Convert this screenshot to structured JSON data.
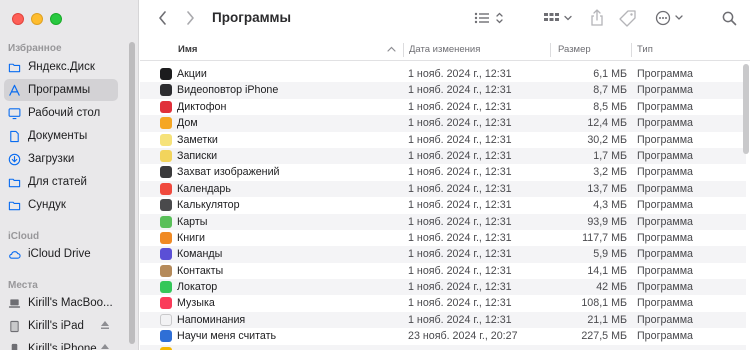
{
  "window": {
    "title": "Программы"
  },
  "sidebar": {
    "favorites_title": "Избранное",
    "favorites": [
      {
        "label": "Яндекс.Диск",
        "icon": "folder-icon"
      },
      {
        "label": "Программы",
        "icon": "applications-icon",
        "selected": true
      },
      {
        "label": "Рабочий стол",
        "icon": "desktop-icon"
      },
      {
        "label": "Документы",
        "icon": "document-icon"
      },
      {
        "label": "Загрузки",
        "icon": "download-icon"
      },
      {
        "label": "Для статей",
        "icon": "folder-icon"
      },
      {
        "label": "Сундук",
        "icon": "folder-icon"
      }
    ],
    "icloud_title": "iCloud",
    "icloud": [
      {
        "label": "iCloud Drive",
        "icon": "cloud-icon"
      }
    ],
    "locations_title": "Места",
    "locations": [
      {
        "label": "Kirill's MacBoo...",
        "icon": "laptop-icon"
      },
      {
        "label": "Kirill's iPad",
        "icon": "ipad-icon"
      },
      {
        "label": "Kirill's iPhone",
        "icon": "iphone-icon"
      }
    ]
  },
  "columns": {
    "name": "Имя",
    "date": "Дата изменения",
    "size": "Размер",
    "type": "Тип"
  },
  "files": [
    {
      "name": "Акции",
      "date": "1 нояб. 2024 г., 12:31",
      "size": "6,1 МБ",
      "type": "Программа",
      "color": "#1c1c1e"
    },
    {
      "name": "Видеоповтор iPhone",
      "date": "1 нояб. 2024 г., 12:31",
      "size": "8,7 МБ",
      "type": "Программа",
      "color": "#2c2c30"
    },
    {
      "name": "Диктофон",
      "date": "1 нояб. 2024 г., 12:31",
      "size": "8,5 МБ",
      "type": "Программа",
      "color": "#e0303a"
    },
    {
      "name": "Дом",
      "date": "1 нояб. 2024 г., 12:31",
      "size": "12,4 МБ",
      "type": "Программа",
      "color": "#f5a623"
    },
    {
      "name": "Заметки",
      "date": "1 нояб. 2024 г., 12:31",
      "size": "30,2 МБ",
      "type": "Программа",
      "color": "#f6e27a"
    },
    {
      "name": "Записки",
      "date": "1 нояб. 2024 г., 12:31",
      "size": "1,7 МБ",
      "type": "Программа",
      "color": "#f2d45c"
    },
    {
      "name": "Захват изображений",
      "date": "1 нояб. 2024 г., 12:31",
      "size": "3,2 МБ",
      "type": "Программа",
      "color": "#3a3a3c"
    },
    {
      "name": "Календарь",
      "date": "1 нояб. 2024 г., 12:31",
      "size": "13,7 МБ",
      "type": "Программа",
      "color": "#f04a3e"
    },
    {
      "name": "Калькулятор",
      "date": "1 нояб. 2024 г., 12:31",
      "size": "4,3 МБ",
      "type": "Программа",
      "color": "#4a4a4c"
    },
    {
      "name": "Карты",
      "date": "1 нояб. 2024 г., 12:31",
      "size": "93,9 МБ",
      "type": "Программа",
      "color": "#5ac05a"
    },
    {
      "name": "Книги",
      "date": "1 нояб. 2024 г., 12:31",
      "size": "117,7 МБ",
      "type": "Программа",
      "color": "#f08a24"
    },
    {
      "name": "Команды",
      "date": "1 нояб. 2024 г., 12:31",
      "size": "5,9 МБ",
      "type": "Программа",
      "color": "#5b4fd6"
    },
    {
      "name": "Контакты",
      "date": "1 нояб. 2024 г., 12:31",
      "size": "14,1 МБ",
      "type": "Программа",
      "color": "#b58a5a"
    },
    {
      "name": "Локатор",
      "date": "1 нояб. 2024 г., 12:31",
      "size": "42 МБ",
      "type": "Программа",
      "color": "#34c759"
    },
    {
      "name": "Музыка",
      "date": "1 нояб. 2024 г., 12:31",
      "size": "108,1 МБ",
      "type": "Программа",
      "color": "#fa3c5a"
    },
    {
      "name": "Напоминания",
      "date": "1 нояб. 2024 г., 12:31",
      "size": "21,1 МБ",
      "type": "Программа",
      "color": "#f2f2f4"
    },
    {
      "name": "Научи меня считать",
      "date": "23 нояб. 2024 г., 20:27",
      "size": "227,5 МБ",
      "type": "Программа",
      "color": "#2f6fd6"
    },
    {
      "name": "",
      "date": "",
      "size": "",
      "type": "",
      "color": "#f5b800"
    }
  ],
  "colors": {
    "accent": "#0a6cf0",
    "selection": "#d3d2d5"
  }
}
